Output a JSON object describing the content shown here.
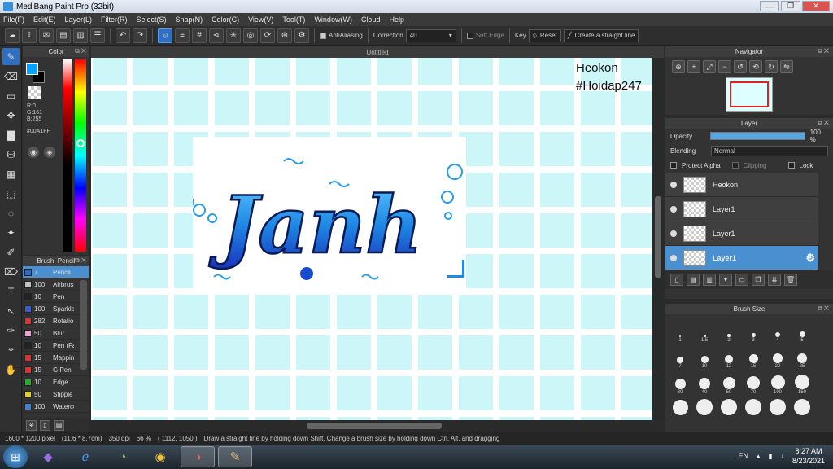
{
  "window": {
    "title": "MediBang Paint Pro (32bit)",
    "min": "—",
    "max": "❐",
    "close": "✕"
  },
  "menu": [
    "File(F)",
    "Edit(E)",
    "Layer(L)",
    "Filter(R)",
    "Select(S)",
    "Snap(N)",
    "Color(C)",
    "View(V)",
    "Tool(T)",
    "Window(W)",
    "Cloud",
    "Help"
  ],
  "toolbar": {
    "antialiasing_label": "AntiAliasing",
    "correction_label": "Correction",
    "correction_value": "40",
    "soft_edge_label": "Soft Edge",
    "key_label": "Key",
    "reset_label": "Reset",
    "straight_line_label": "Create a straight line"
  },
  "color_panel": {
    "title": "Color",
    "r": "R:0",
    "g": "G:161",
    "b": "B:255",
    "hex": "#00A1FF",
    "primary_color": "#00a1ff",
    "secondary_color": "#000000"
  },
  "brush_panel": {
    "title": "Brush: Pencil",
    "items": [
      {
        "size": "7",
        "name": "Pencil",
        "color": "#2a6ad0"
      },
      {
        "size": "100",
        "name": "Airbrush",
        "color": "#c0c0c0"
      },
      {
        "size": "10",
        "name": "Pen",
        "color": "#222222"
      },
      {
        "size": "100",
        "name": "Sparkle",
        "color": "#3a5be0"
      },
      {
        "size": "282",
        "name": "Rotation",
        "color": "#e03030"
      },
      {
        "size": "50",
        "name": "Blur",
        "color": "#f0a0d0"
      },
      {
        "size": "10",
        "name": "Pen (Fade)",
        "color": "#222222"
      },
      {
        "size": "15",
        "name": "Mapping",
        "color": "#e03030"
      },
      {
        "size": "15",
        "name": "G Pen",
        "color": "#e03030"
      },
      {
        "size": "10",
        "name": "Edge",
        "color": "#20b020"
      },
      {
        "size": "50",
        "name": "Stipple",
        "color": "#e0d020"
      },
      {
        "size": "100",
        "name": "Watercolor",
        "color": "#3a80e0"
      }
    ]
  },
  "canvas": {
    "tab_title": "Untitled",
    "watermark_line1": "Heokon",
    "watermark_line2": "#Hoidap247",
    "art_text": "Janh"
  },
  "navigator": {
    "title": "Navigator"
  },
  "layer_panel": {
    "title": "Layer",
    "opacity_label": "Opacity",
    "opacity_value": "100 %",
    "opacity_fraction": 1.0,
    "blending_label": "Blending",
    "blending_value": "Normal",
    "protect_alpha_label": "Protect Alpha",
    "clipping_label": "Clipping",
    "lock_label": "Lock",
    "layers": [
      {
        "name": "Heokon",
        "selected": false
      },
      {
        "name": "Layer1",
        "selected": false
      },
      {
        "name": "Layer1",
        "selected": false
      },
      {
        "name": "Layer1",
        "selected": true
      }
    ]
  },
  "brush_size_panel": {
    "title": "Brush Size",
    "sizes": [
      "1",
      "1.5",
      "2",
      "3",
      "4",
      "5",
      "7",
      "10",
      "12",
      "15",
      "20",
      "25",
      "30",
      "40",
      "50",
      "70",
      "100",
      "150",
      "",
      "",
      "",
      "",
      "",
      ""
    ]
  },
  "status_bar": {
    "dimensions": "1600 * 1200 pixel",
    "physical": "(11.6 * 8.7cm)",
    "dpi": "350 dpi",
    "zoom": "66 %",
    "cursor": "( 1112, 1050 )",
    "hint": "Draw a straight line by holding down Shift, Change a brush size by holding down Ctrl, Alt, and dragging"
  },
  "taskbar": {
    "language": "EN",
    "time": "8:27 AM",
    "date": "8/23/2021"
  }
}
